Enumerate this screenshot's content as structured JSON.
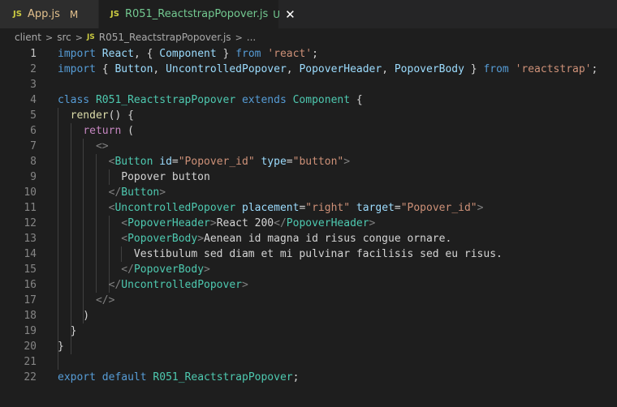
{
  "tabs": [
    {
      "icon": "JS",
      "name": "App.js",
      "status": "M"
    },
    {
      "icon": "JS",
      "name": "R051_ReactstrapPopover.js",
      "status": "U",
      "close": "✕"
    }
  ],
  "breadcrumb": {
    "items": [
      "client",
      "src"
    ],
    "file_icon": "JS",
    "file": "R051_ReactstrapPopover.js",
    "more": "..."
  },
  "editor": {
    "current_line": 1,
    "lines": [
      {
        "n": "1",
        "tokens": [
          [
            "kw",
            "import"
          ],
          [
            "txt",
            " "
          ],
          [
            "var",
            "React"
          ],
          [
            "txt",
            ", { "
          ],
          [
            "var",
            "Component"
          ],
          [
            "txt",
            " } "
          ],
          [
            "kw",
            "from"
          ],
          [
            "txt",
            " "
          ],
          [
            "str",
            "'react'"
          ],
          [
            "txt",
            ";"
          ]
        ]
      },
      {
        "n": "2",
        "tokens": [
          [
            "kw",
            "import"
          ],
          [
            "txt",
            " { "
          ],
          [
            "var",
            "Button"
          ],
          [
            "txt",
            ", "
          ],
          [
            "var",
            "UncontrolledPopover"
          ],
          [
            "txt",
            ", "
          ],
          [
            "var",
            "PopoverHeader"
          ],
          [
            "txt",
            ", "
          ],
          [
            "var",
            "PopoverBody"
          ],
          [
            "txt",
            " } "
          ],
          [
            "kw",
            "from"
          ],
          [
            "txt",
            " "
          ],
          [
            "str",
            "'reactstrap'"
          ],
          [
            "txt",
            ";"
          ]
        ]
      },
      {
        "n": "3",
        "tokens": []
      },
      {
        "n": "4",
        "tokens": [
          [
            "kw",
            "class"
          ],
          [
            "txt",
            " "
          ],
          [
            "cls",
            "R051_ReactstrapPopover"
          ],
          [
            "txt",
            " "
          ],
          [
            "kw",
            "extends"
          ],
          [
            "txt",
            " "
          ],
          [
            "cls",
            "Component"
          ],
          [
            "txt",
            " {"
          ]
        ]
      },
      {
        "n": "5",
        "tokens": [
          [
            "txt",
            "  "
          ],
          [
            "fn",
            "render"
          ],
          [
            "txt",
            "() {"
          ]
        ]
      },
      {
        "n": "6",
        "tokens": [
          [
            "txt",
            "    "
          ],
          [
            "ctl",
            "return"
          ],
          [
            "txt",
            " ("
          ]
        ]
      },
      {
        "n": "7",
        "tokens": [
          [
            "txt",
            "      "
          ],
          [
            "tag",
            "<>"
          ]
        ]
      },
      {
        "n": "8",
        "tokens": [
          [
            "txt",
            "        "
          ],
          [
            "tag",
            "<"
          ],
          [
            "comp",
            "Button"
          ],
          [
            "txt",
            " "
          ],
          [
            "attr",
            "id"
          ],
          [
            "txt",
            "="
          ],
          [
            "str",
            "\"Popover_id\""
          ],
          [
            "txt",
            " "
          ],
          [
            "attr",
            "type"
          ],
          [
            "txt",
            "="
          ],
          [
            "str",
            "\"button\""
          ],
          [
            "tag",
            ">"
          ]
        ]
      },
      {
        "n": "9",
        "tokens": [
          [
            "txt",
            "          Popover button"
          ]
        ]
      },
      {
        "n": "10",
        "tokens": [
          [
            "txt",
            "        "
          ],
          [
            "tag",
            "</"
          ],
          [
            "comp",
            "Button"
          ],
          [
            "tag",
            ">"
          ]
        ]
      },
      {
        "n": "11",
        "tokens": [
          [
            "txt",
            "        "
          ],
          [
            "tag",
            "<"
          ],
          [
            "comp",
            "UncontrolledPopover"
          ],
          [
            "txt",
            " "
          ],
          [
            "attr",
            "placement"
          ],
          [
            "txt",
            "="
          ],
          [
            "str",
            "\"right\""
          ],
          [
            "txt",
            " "
          ],
          [
            "attr",
            "target"
          ],
          [
            "txt",
            "="
          ],
          [
            "str",
            "\"Popover_id\""
          ],
          [
            "tag",
            ">"
          ]
        ]
      },
      {
        "n": "12",
        "tokens": [
          [
            "txt",
            "          "
          ],
          [
            "tag",
            "<"
          ],
          [
            "comp",
            "PopoverHeader"
          ],
          [
            "tag",
            ">"
          ],
          [
            "txt",
            "React 200"
          ],
          [
            "tag",
            "</"
          ],
          [
            "comp",
            "PopoverHeader"
          ],
          [
            "tag",
            ">"
          ]
        ]
      },
      {
        "n": "13",
        "tokens": [
          [
            "txt",
            "          "
          ],
          [
            "tag",
            "<"
          ],
          [
            "comp",
            "PopoverBody"
          ],
          [
            "tag",
            ">"
          ],
          [
            "txt",
            "Aenean id magna id risus congue ornare."
          ]
        ]
      },
      {
        "n": "14",
        "tokens": [
          [
            "txt",
            "            Vestibulum sed diam et mi pulvinar facilisis sed eu risus."
          ]
        ]
      },
      {
        "n": "15",
        "tokens": [
          [
            "txt",
            "          "
          ],
          [
            "tag",
            "</"
          ],
          [
            "comp",
            "PopoverBody"
          ],
          [
            "tag",
            ">"
          ]
        ]
      },
      {
        "n": "16",
        "tokens": [
          [
            "txt",
            "        "
          ],
          [
            "tag",
            "</"
          ],
          [
            "comp",
            "UncontrolledPopover"
          ],
          [
            "tag",
            ">"
          ]
        ]
      },
      {
        "n": "17",
        "tokens": [
          [
            "txt",
            "      "
          ],
          [
            "tag",
            "</>"
          ]
        ]
      },
      {
        "n": "18",
        "tokens": [
          [
            "txt",
            "    )"
          ]
        ]
      },
      {
        "n": "19",
        "tokens": [
          [
            "txt",
            "  }"
          ]
        ]
      },
      {
        "n": "20",
        "tokens": [
          [
            "txt",
            "}"
          ]
        ]
      },
      {
        "n": "21",
        "tokens": []
      },
      {
        "n": "22",
        "tokens": [
          [
            "kw",
            "export"
          ],
          [
            "txt",
            " "
          ],
          [
            "kw",
            "default"
          ],
          [
            "txt",
            " "
          ],
          [
            "cls",
            "R051_ReactstrapPopover"
          ],
          [
            "txt",
            ";"
          ]
        ]
      }
    ]
  },
  "colors": {
    "background": "#1e1e1e",
    "keyword": "#569cd6",
    "control": "#c586c0",
    "string": "#ce9178",
    "variable": "#9cdcfe",
    "class": "#4ec9b0",
    "function": "#dcdcaa",
    "tag_bracket": "#808080"
  }
}
